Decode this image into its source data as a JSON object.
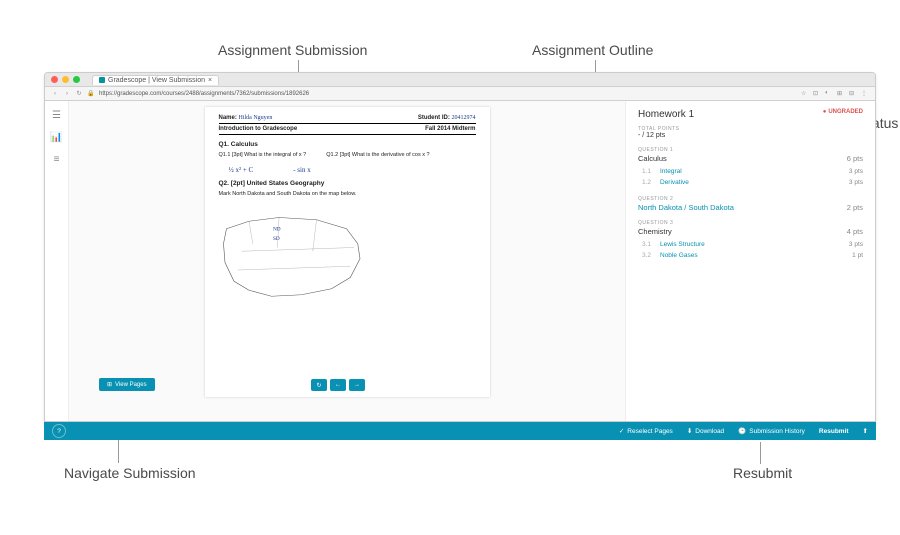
{
  "annotations": {
    "submission": "Assignment Submission",
    "outline": "Assignment Outline",
    "grading_status": "Grading Status",
    "navigate": "Navigate Submission",
    "resubmit": "Resubmit"
  },
  "browser": {
    "tab_title": "Gradescope | View Submission",
    "url": "https://gradescope.com/courses/2488/assignments/7362/submissions/1892626"
  },
  "page": {
    "name_label": "Name:",
    "name_value": "Hilda Nguyen",
    "sid_label": "Student ID:",
    "sid_value": "20412974",
    "course": "Introduction to Gradescope",
    "term": "Fall 2014 Midterm",
    "q1_title": "Q1. Calculus",
    "q1_1": "Q1.1  [3pt] What is the integral of x ?",
    "q1_2": "Q1.2  [3pt] What is the derivative of  cos x ?",
    "q1_1_ans": "½ x² + C",
    "q1_2_ans": "- sin x",
    "q2_title": "Q2. [2pt] United States Geography",
    "q2_sub": "Mark North Dakota and South Dakota on the map below."
  },
  "view_pages": "View Pages",
  "outline": {
    "title": "Homework 1",
    "status": "UNGRADED",
    "total_label": "TOTAL POINTS",
    "total_value": "- / 12 pts",
    "questions": [
      {
        "num": "QUESTION 1",
        "name": "Calculus",
        "pts": "6 pts",
        "subs": [
          {
            "idx": "1.1",
            "name": "Integral",
            "pts": "3 pts"
          },
          {
            "idx": "1.2",
            "name": "Derivative",
            "pts": "3 pts"
          }
        ]
      },
      {
        "num": "QUESTION 2",
        "name": "North Dakota / South Dakota",
        "pts": "2 pts",
        "link": true,
        "subs": []
      },
      {
        "num": "QUESTION 3",
        "name": "Chemistry",
        "pts": "4 pts",
        "subs": [
          {
            "idx": "3.1",
            "name": "Lewis Structure",
            "pts": "3 pts"
          },
          {
            "idx": "3.2",
            "name": "Noble Gases",
            "pts": "1 pt"
          }
        ]
      }
    ]
  },
  "bottom_bar": {
    "reselect": "Reselect Pages",
    "download": "Download",
    "history": "Submission History",
    "resubmit": "Resubmit"
  }
}
